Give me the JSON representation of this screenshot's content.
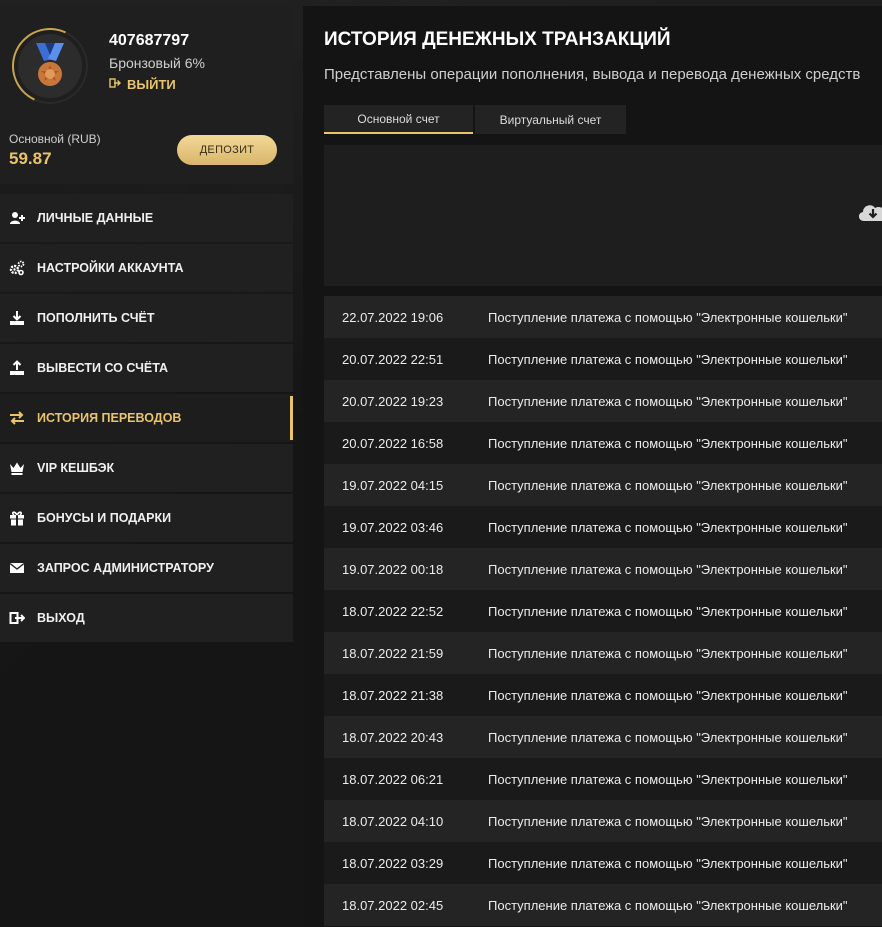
{
  "profile": {
    "user_id": "407687797",
    "level": "Бронзовый 6%",
    "logout": "ВЫЙТИ",
    "balance_label": "Основной (RUB)",
    "balance_value": "59.87",
    "deposit_button": "ДЕПОЗИТ"
  },
  "menu": {
    "items": [
      {
        "label": "ЛИЧНЫЕ ДАННЫЕ",
        "icon": "user-plus-icon"
      },
      {
        "label": "НАСТРОЙКИ АККАУНТА",
        "icon": "gears-icon"
      },
      {
        "label": "ПОПОЛНИТЬ СЧЁТ",
        "icon": "download-icon"
      },
      {
        "label": "ВЫВЕСТИ СО СЧЁТА",
        "icon": "upload-icon"
      },
      {
        "label": "ИСТОРИЯ ПЕРЕВОДОВ",
        "icon": "exchange-icon",
        "active": true
      },
      {
        "label": "VIP КЕШБЭК",
        "icon": "crown-icon"
      },
      {
        "label": "БОНУСЫ И ПОДАРКИ",
        "icon": "gift-icon"
      },
      {
        "label": "ЗАПРОС АДМИНИСТРАТОРУ",
        "icon": "envelope-icon"
      },
      {
        "label": "ВЫХОД",
        "icon": "sign-out-icon"
      }
    ]
  },
  "main": {
    "title": "ИСТОРИЯ ДЕНЕЖНЫХ ТРАНЗАКЦИЙ",
    "subtitle": "Представлены операции пополнения, вывода и перевода денежных средств",
    "tabs": [
      "Основной счет",
      "Виртуальный счет"
    ],
    "download_icon": "cloud-download-icon"
  },
  "transactions": [
    {
      "date": "22.07.2022 19:06",
      "desc": "Поступление платежа с помощью \"Электронные кошельки\""
    },
    {
      "date": "20.07.2022 22:51",
      "desc": "Поступление платежа с помощью \"Электронные кошельки\""
    },
    {
      "date": "20.07.2022 19:23",
      "desc": "Поступление платежа с помощью \"Электронные кошельки\""
    },
    {
      "date": "20.07.2022 16:58",
      "desc": "Поступление платежа с помощью \"Электронные кошельки\""
    },
    {
      "date": "19.07.2022 04:15",
      "desc": "Поступление платежа с помощью \"Электронные кошельки\""
    },
    {
      "date": "19.07.2022 03:46",
      "desc": "Поступление платежа с помощью \"Электронные кошельки\""
    },
    {
      "date": "19.07.2022 00:18",
      "desc": "Поступление платежа с помощью \"Электронные кошельки\""
    },
    {
      "date": "18.07.2022 22:52",
      "desc": "Поступление платежа с помощью \"Электронные кошельки\""
    },
    {
      "date": "18.07.2022 21:59",
      "desc": "Поступление платежа с помощью \"Электронные кошельки\""
    },
    {
      "date": "18.07.2022 21:38",
      "desc": "Поступление платежа с помощью \"Электронные кошельки\""
    },
    {
      "date": "18.07.2022 20:43",
      "desc": "Поступление платежа с помощью \"Электронные кошельки\""
    },
    {
      "date": "18.07.2022 06:21",
      "desc": "Поступление платежа с помощью \"Электронные кошельки\""
    },
    {
      "date": "18.07.2022 04:10",
      "desc": "Поступление платежа с помощью \"Электронные кошельки\""
    },
    {
      "date": "18.07.2022 03:29",
      "desc": "Поступление платежа с помощью \"Электронные кошельки\""
    },
    {
      "date": "18.07.2022 02:45",
      "desc": "Поступление платежа с помощью \"Электронные кошельки\""
    }
  ],
  "colors": {
    "accent": "#e9c46a"
  }
}
